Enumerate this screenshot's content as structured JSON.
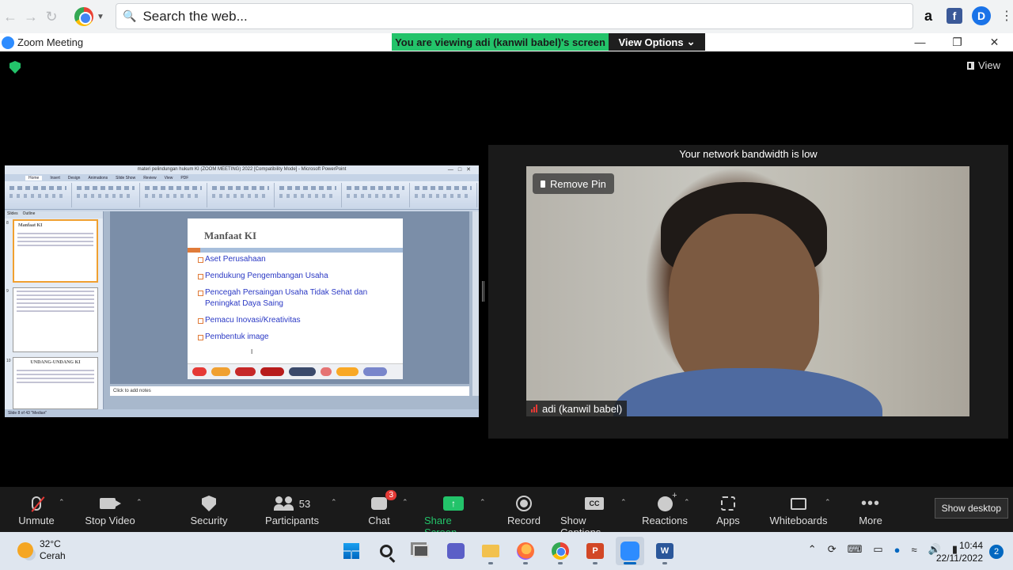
{
  "browser": {
    "search_placeholder": "Search the web...",
    "ext_amazon": "a",
    "ext_facebook": "f",
    "ext_profile": "D"
  },
  "zoom_window": {
    "title": "Zoom Meeting",
    "share_banner": "You are viewing adi (kanwil babel)'s screen",
    "view_options": "View Options",
    "view_label": "View"
  },
  "ppt": {
    "window_title": "materi pelindungan hukum KI (ZOOM MEETING) 2022 [Compatibility Mode] - Microsoft PowerPoint",
    "tabs": [
      "Home",
      "Insert",
      "Design",
      "Animations",
      "Slide Show",
      "Review",
      "View",
      "PDF"
    ],
    "pane_tabs": [
      "Slides",
      "Outline"
    ],
    "thumb_numbers": [
      "8",
      "9",
      "10"
    ],
    "thumb_titles": [
      "Manfaat KI",
      "",
      "UNDANG-UNDANG KI"
    ],
    "slide": {
      "title": "Manfaat KI",
      "bullets": [
        "Aset Perusahaan",
        "Pendukung Pengembangan Usaha",
        "Pencegah Persaingan Usaha Tidak Sehat dan Peningkat Daya Saing",
        "Pemacu Inovasi/Kreativitas",
        "Pembentuk image"
      ]
    },
    "notes_placeholder": "Click to add notes",
    "status": "Slide 8 of 43   \"Median\""
  },
  "video": {
    "bandwidth_msg": "Your network bandwidth is low",
    "remove_pin": "Remove Pin",
    "participant_name": "adi (kanwil babel)"
  },
  "toolbar": {
    "items": [
      {
        "label": "Unmute",
        "icon": "mic-muted-icon"
      },
      {
        "label": "Stop Video",
        "icon": "camera-icon"
      },
      {
        "label": "Security",
        "icon": "shield-icon"
      },
      {
        "label": "Participants",
        "icon": "people-icon",
        "count": "53"
      },
      {
        "label": "Chat",
        "icon": "chat-icon",
        "badge": "3"
      },
      {
        "label": "Share Screen",
        "icon": "share-screen-icon"
      },
      {
        "label": "Record",
        "icon": "record-icon"
      },
      {
        "label": "Show Captions",
        "icon": "captions-icon",
        "icon_text": "CC"
      },
      {
        "label": "Reactions",
        "icon": "reactions-icon"
      },
      {
        "label": "Apps",
        "icon": "apps-icon"
      },
      {
        "label": "Whiteboards",
        "icon": "whiteboard-icon"
      },
      {
        "label": "More",
        "icon": "more-icon"
      }
    ],
    "show_desktop": "Show desktop"
  },
  "taskbar": {
    "temperature": "32°C",
    "weather": "Cerah",
    "ppt_letter": "P",
    "word_letter": "W",
    "time": "10:44",
    "date": "22/11/2022",
    "notifications": "2"
  },
  "colors": {
    "zoom_green": "#23c36a",
    "zoom_blue": "#2d8cff",
    "slide_text": "#2a38c4",
    "muted_red": "#e53935"
  }
}
